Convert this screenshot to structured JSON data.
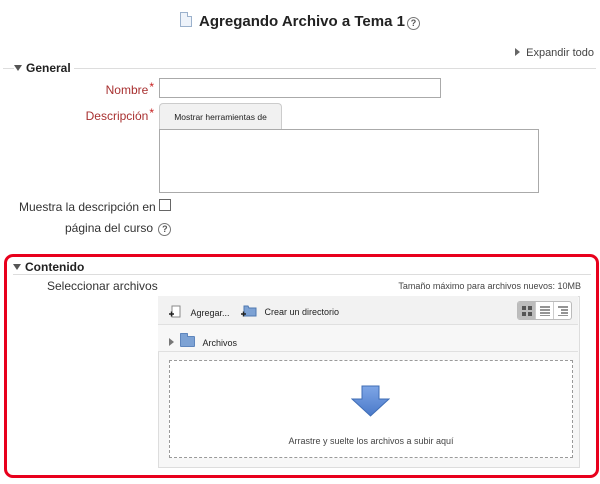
{
  "page": {
    "title": "Agregando Archivo a Tema 1",
    "help_glyph": "?",
    "expand_all": "Expandir todo"
  },
  "general": {
    "legend": "General",
    "nombre_label": "Nombre",
    "required_mark": "*",
    "nombre_value": "",
    "descripcion_label": "Descripción",
    "editor_toggle": "Mostrar herramientas de edición",
    "descripcion_value": "",
    "show_desc_label_line1": "Muestra la descripción en la",
    "show_desc_label_line2": "página del curso",
    "show_desc_checked": false
  },
  "contenido": {
    "legend": "Contenido",
    "select_files_label": "Seleccionar archivos",
    "max_size": "Tamaño máximo para archivos nuevos: 10MB",
    "add_label": "Agregar...",
    "create_dir_label": "Crear un directorio",
    "path_label": "Archivos",
    "drop_hint": "Arrastre y suelte los archivos a subir aquí"
  },
  "colors": {
    "highlight_border": "#e8001c",
    "required": "#c82020",
    "drop_arrow": "#5b8bd9"
  },
  "icons": [
    "file-icon",
    "help-icon",
    "expand-triangle-icon",
    "collapse-triangle-icon",
    "add-file-icon",
    "folder-add-icon",
    "icons-view-icon",
    "list-view-icon",
    "tree-view-icon",
    "folder-icon",
    "down-arrow-icon"
  ]
}
